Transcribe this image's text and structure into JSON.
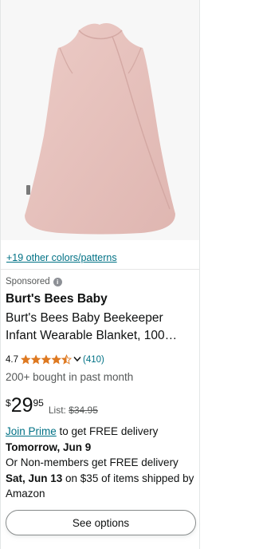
{
  "product": {
    "image_alt_name": "wearable-blanket-image",
    "colors_link": "+19 other colors/patterns",
    "sponsored_label": "Sponsored",
    "info_glyph": "i",
    "brand": "Burt's Bees Baby",
    "title": "Burt's Bees Baby Beekeeper Infant Wearable Blanket, 100…",
    "rating": {
      "value": "4.7",
      "stars_out_of_5": 4.5,
      "review_count": "(410)"
    },
    "bought_text": "200+ bought in past month",
    "price": {
      "symbol": "$",
      "whole": "29",
      "fraction": "95",
      "list_label": "List: ",
      "list_price": "$34.95"
    },
    "delivery": {
      "prime_link": "Join Prime",
      "prime_text": " to get FREE delivery",
      "prime_date": "Tomorrow, Jun 9",
      "nonmember_text": "Or Non-members get FREE delivery",
      "nonmember_date": "Sat, Jun 13",
      "nonmember_suffix": " on $35 of items shipped by Amazon"
    },
    "see_options_label": "See options"
  },
  "colors": {
    "link": "#007185",
    "star": "#de7921",
    "text": "#0f1111",
    "secondary": "#565959",
    "product_pink": "#e8c4c0"
  },
  "icons": {
    "info": "info-icon",
    "star": "star-icon",
    "chevron": "chevron-down-icon"
  }
}
